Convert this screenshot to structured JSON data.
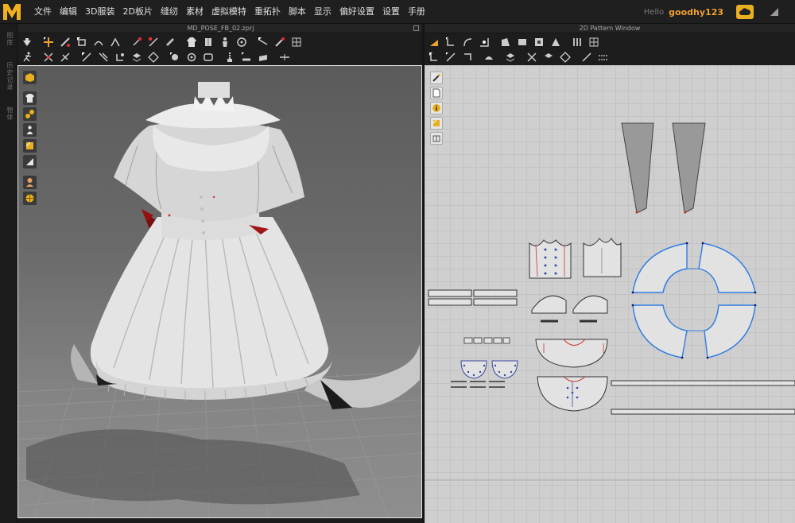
{
  "menubar": {
    "items": [
      "文件",
      "编辑",
      "3D服装",
      "2D板片",
      "缝纫",
      "素材",
      "虚拟模特",
      "重拓扑",
      "脚本",
      "显示",
      "偏好设置",
      "设置",
      "手册"
    ]
  },
  "user": {
    "greeting": "Hello",
    "name": "goodhy123"
  },
  "leftstrip": {
    "tabs": [
      "图库",
      "历史记录",
      "物体"
    ]
  },
  "window3d": {
    "title": "MD_POSE_FB_02.zprj"
  },
  "window2d": {
    "title": "2D Pattern Window"
  },
  "colors": {
    "accent": "#f0a030",
    "logo": "#f2b01e",
    "selected_outline": "#2f7de1",
    "seam_red": "#c83232"
  }
}
